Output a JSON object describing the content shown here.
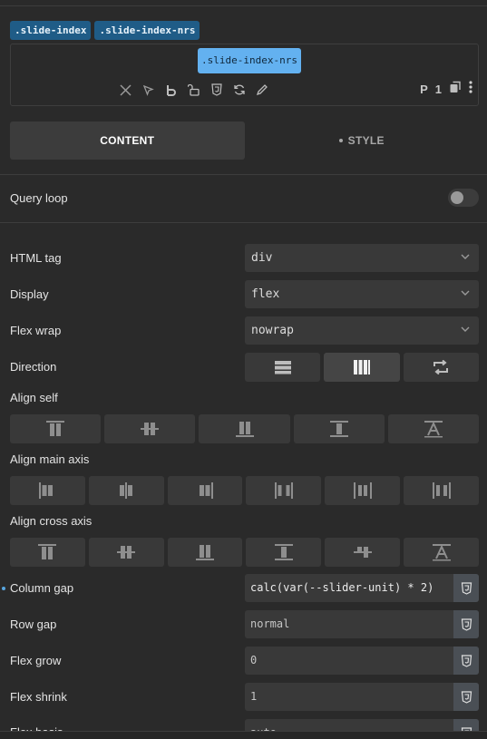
{
  "selector": {
    "tags": [
      ".slide-index",
      ".slide-index-nrs"
    ],
    "active_class": ".slide-index-nrs",
    "icons": [
      "close-icon",
      "cursor-icon",
      "bold-b-icon",
      "unlock-icon",
      "css3-icon",
      "refresh-icon",
      "pencil-icon"
    ],
    "p_label": "P",
    "count": "1"
  },
  "tabs": {
    "content": "CONTENT",
    "style": "STYLE"
  },
  "query_loop": {
    "label": "Query loop",
    "enabled": false
  },
  "fields": {
    "html_tag": {
      "label": "HTML tag",
      "value": "div"
    },
    "display": {
      "label": "Display",
      "value": "flex"
    },
    "flex_wrap": {
      "label": "Flex wrap",
      "value": "nowrap"
    },
    "direction": {
      "label": "Direction",
      "options": [
        "column-icon",
        "row-icon",
        "reverse-icon"
      ],
      "selected": 1
    },
    "align_self": {
      "label": "Align self",
      "options": [
        "align-start-icon",
        "align-center-icon",
        "align-end-icon",
        "align-stretch-icon",
        "align-baseline-icon"
      ]
    },
    "align_main": {
      "label": "Align main axis",
      "options": [
        "justify-start-icon",
        "justify-center-icon",
        "justify-end-icon",
        "justify-between-icon",
        "justify-around-icon",
        "justify-evenly-icon"
      ]
    },
    "align_cross": {
      "label": "Align cross axis",
      "options": [
        "items-start-icon",
        "items-center-icon",
        "items-end-icon",
        "items-stretch-icon",
        "items-baseline-icon",
        "items-text-icon"
      ]
    },
    "column_gap": {
      "label": "Column gap",
      "value": "calc(var(--slider-unit) * 2)"
    },
    "row_gap": {
      "label": "Row gap",
      "placeholder": "normal"
    },
    "flex_grow": {
      "label": "Flex grow",
      "placeholder": "0"
    },
    "flex_shrink": {
      "label": "Flex shrink",
      "placeholder": "1"
    },
    "flex_basis": {
      "label": "Flex basis",
      "placeholder": "auto"
    }
  },
  "colors": {
    "accent": "#63b1f0",
    "tag_bg": "#1f5c87",
    "panel_bg": "#2a2a2a",
    "control_bg": "#393939"
  }
}
